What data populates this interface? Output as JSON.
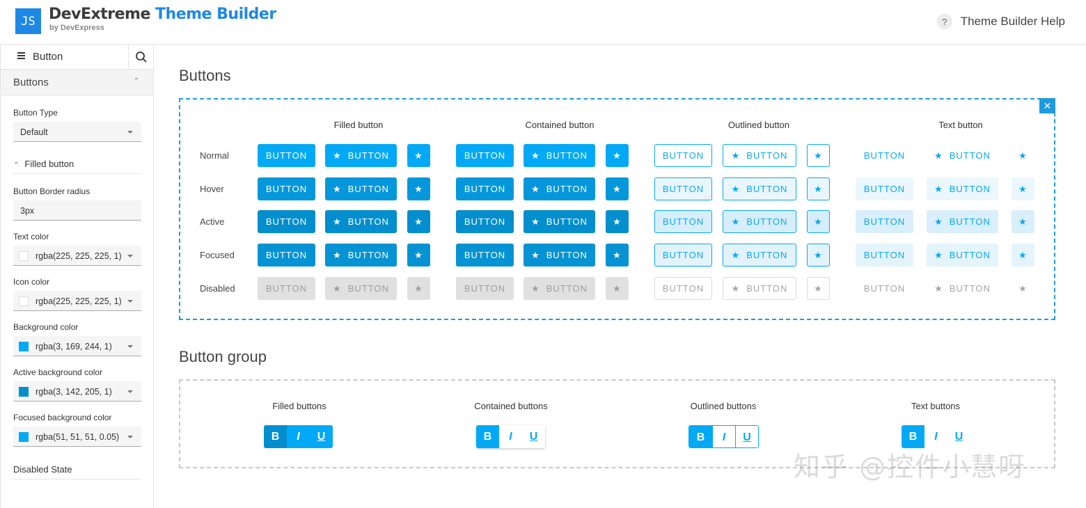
{
  "header": {
    "logo_text": "JS",
    "title_part1": "DevExtreme",
    "title_part2": "Theme Builder",
    "subtitle": "by DevExpress",
    "help_icon": "?",
    "help_label": "Theme Builder Help"
  },
  "sidebar": {
    "search_label": "Button",
    "section_title": "Buttons",
    "button_type_label": "Button Type",
    "button_type_value": "Default",
    "subsection_title": "Filled button",
    "border_radius_label": "Button Border radius",
    "border_radius_value": "3px",
    "text_color_label": "Text color",
    "text_color_value": "rgba(225, 225, 225, 1)",
    "icon_color_label": "Icon color",
    "icon_color_value": "rgba(225, 225, 225, 1)",
    "bg_color_label": "Background color",
    "bg_color_value": "rgba(3, 169, 244, 1)",
    "active_bg_label": "Active background color",
    "active_bg_value": "rgba(3, 142, 205, 1)",
    "focused_bg_label": "Focused background color",
    "focused_bg_value": "rgba(51, 51, 51, 0.05)",
    "disabled_state_label": "Disabled State"
  },
  "main": {
    "buttons_title": "Buttons",
    "close_icon": "✕",
    "columns": [
      "Filled button",
      "Contained button",
      "Outlined button",
      "Text button"
    ],
    "rows": [
      "Normal",
      "Hover",
      "Active",
      "Focused",
      "Disabled"
    ],
    "button_label": "BUTTON",
    "star_glyph": "★",
    "group_title": "Button group",
    "group_columns": [
      "Filled buttons",
      "Contained buttons",
      "Outlined buttons",
      "Text buttons"
    ],
    "group_glyphs": [
      "B",
      "I",
      "U"
    ]
  },
  "watermark": "知乎 @控件小慧呀",
  "colors": {
    "accent": "#03a9f4",
    "active": "#038ecd",
    "logo": "#1e88e5",
    "disabled": "#e0e0e0"
  }
}
